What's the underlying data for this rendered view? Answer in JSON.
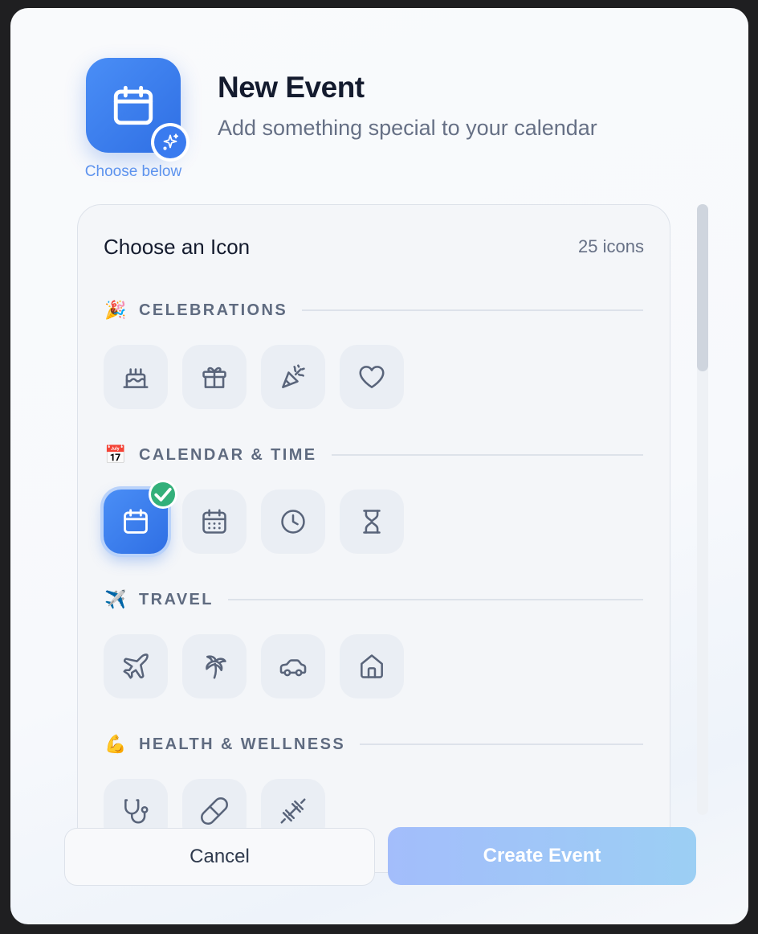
{
  "header": {
    "title": "New Event",
    "subtitle": "Add something special to your calendar",
    "icon_hint": "Choose below",
    "app_icon": "calendar-icon",
    "badge_icon": "sparkle-icon"
  },
  "picker": {
    "title": "Choose an Icon",
    "count": "25 icons",
    "selected": "calendar",
    "sections": [
      {
        "emoji": "🎉",
        "label": "CELEBRATIONS",
        "icons": [
          "cake",
          "gift",
          "party-popper",
          "heart"
        ]
      },
      {
        "emoji": "📅",
        "label": "CALENDAR & TIME",
        "icons": [
          "calendar",
          "calendar-days",
          "clock",
          "hourglass"
        ]
      },
      {
        "emoji": "✈️",
        "label": "TRAVEL",
        "icons": [
          "plane",
          "palm-tree",
          "car",
          "home"
        ]
      },
      {
        "emoji": "💪",
        "label": "HEALTH & WELLNESS",
        "icons": [
          "stethoscope",
          "pill",
          "dumbbell"
        ]
      }
    ]
  },
  "footer": {
    "cancel_label": "Cancel",
    "create_label": "Create Event"
  },
  "colors": {
    "accent": "#3a7bef",
    "selected_check": "#33b07a",
    "title": "#141b2e",
    "muted": "#667085"
  }
}
